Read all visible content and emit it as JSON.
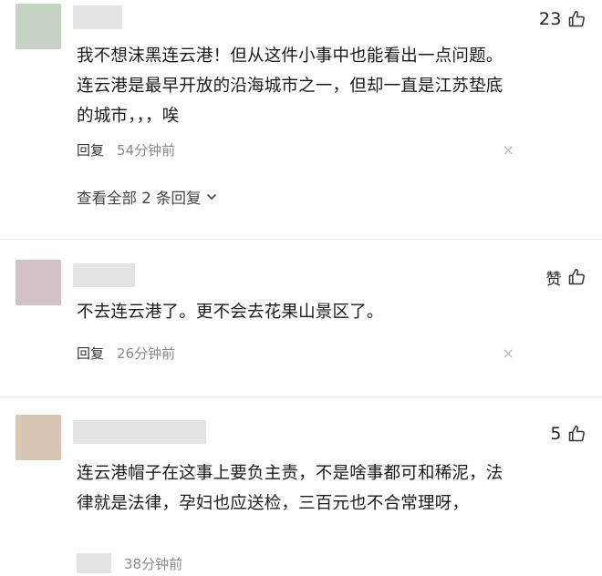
{
  "comments": [
    {
      "avatar_color": "#c6d3c4",
      "likes": "23",
      "text": "我不想沫黑连云港！但从这件小事中也能看出一点问题。连云港是最早开放的沿海城市之一，但却一直是江苏垫底的城市，，，唉",
      "reply_label": "回复",
      "time": "54分钟前",
      "view_replies": "查看全部 2 条回复",
      "close_glyph": "×"
    },
    {
      "avatar_color": "#d0c2c7",
      "likes": "赞",
      "text": "不去连云港了。更不会去花果山景区了。",
      "reply_label": "回复",
      "time": "26分钟前",
      "close_glyph": "×"
    },
    {
      "avatar_color": "#d7c6b4",
      "likes": "5",
      "text": "连云港帽子在这事上要负主责，不是啥事都可和稀泥，法律就是法律，孕妇也应送检，三百元也不合常理呀，",
      "reply_label": "",
      "time": "38分钟前"
    }
  ]
}
